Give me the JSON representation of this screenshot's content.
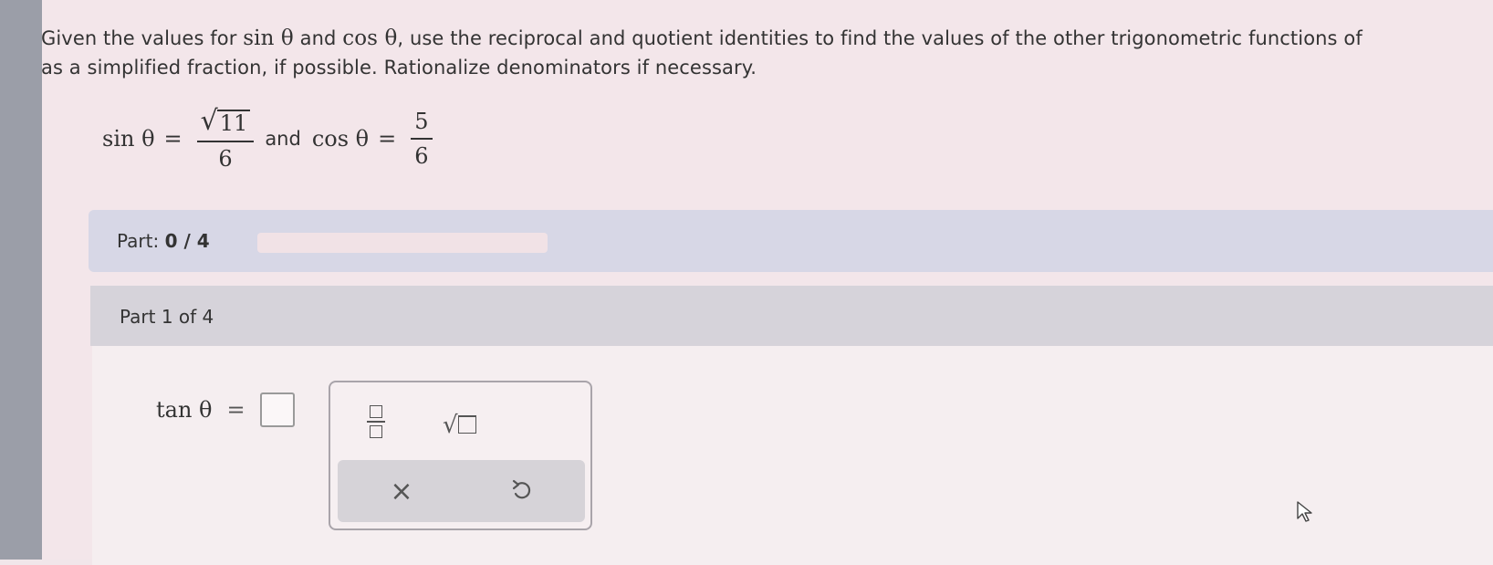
{
  "question": {
    "text_1": "Given the values for ",
    "sin_label": "sin θ",
    "text_2": " and ",
    "cos_label": "cos θ",
    "text_3": ", use the reciprocal and quotient identities to find the values of the other trigonometric functions of",
    "text_4": "as a simplified fraction, if possible. Rationalize denominators if necessary."
  },
  "given": {
    "sin_lhs": "sin θ",
    "equals": "=",
    "sin_num_radicand": "11",
    "sin_den": "6",
    "and_word": "and",
    "cos_lhs": "cos θ",
    "cos_num": "5",
    "cos_den": "6"
  },
  "progress": {
    "label": "Part:",
    "value": "0 / 4",
    "fraction_complete": 0
  },
  "part": {
    "title": "Part 1 of 4",
    "tan_lhs": "tan θ",
    "equals": "="
  },
  "keypad": {
    "fraction_icon": "fraction-icon",
    "sqrt_icon": "sqrt-icon",
    "clear_symbol": "×",
    "undo_icon": "undo-icon"
  },
  "colors": {
    "rail": "#9b9ea8",
    "background": "#f3e6ea",
    "progress_bar_bg": "#d7d7e6",
    "part_header_bg": "#d6d3da"
  }
}
